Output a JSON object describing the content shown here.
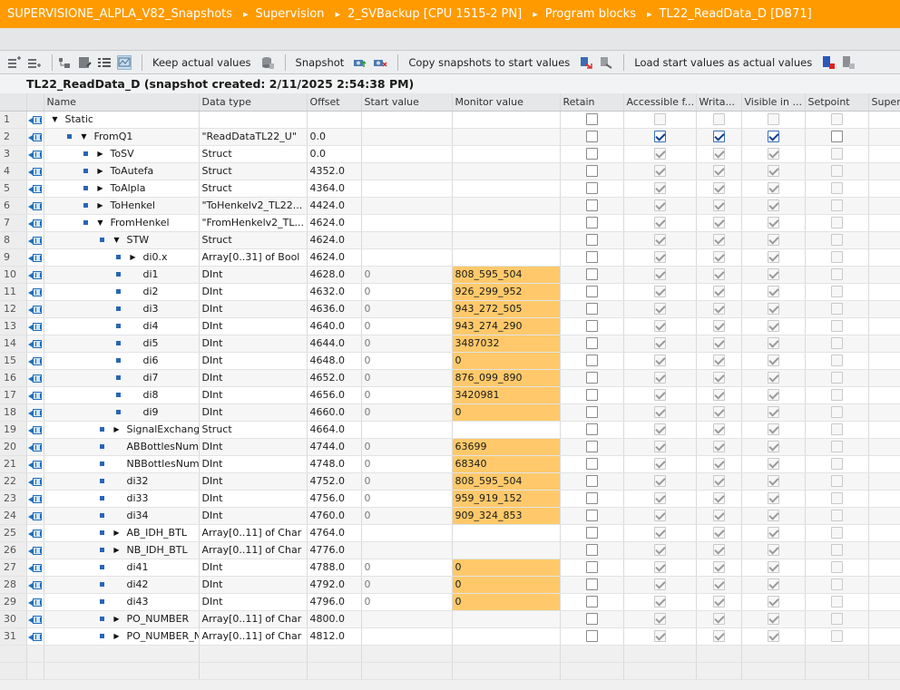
{
  "breadcrumb": [
    "SUPERVISIONE_ALPLA_V82_Snapshots",
    "Supervision",
    "2_SVBackup [CPU 1515-2 PN]",
    "Program blocks",
    "TL22_ReadData_D [DB71]"
  ],
  "toolbar": {
    "keep_actual_values": "Keep actual values",
    "snapshot": "Snapshot",
    "copy_snapshots": "Copy snapshots to start values",
    "load_start_values": "Load start values as actual values"
  },
  "block_title": "TL22_ReadData_D (snapshot created: 2/11/2025 2:54:38 PM)",
  "columns": {
    "name": "Name",
    "data_type": "Data type",
    "offset": "Offset",
    "start_value": "Start value",
    "monitor_value": "Monitor value",
    "retain": "Retain",
    "accessible": "Accessible f...",
    "writable": "Writa...",
    "visible": "Visible in ...",
    "setpoint": "Setpoint",
    "supervision": "Super"
  },
  "rows": [
    {
      "n": "1",
      "name": "Static",
      "type": "",
      "offset": "",
      "start": "",
      "monitor": "",
      "level": 0,
      "tri": "down",
      "bullet": false,
      "hl": false,
      "acc": false,
      "wr": false,
      "vis": false,
      "dim": true
    },
    {
      "n": "2",
      "name": "FromQ1",
      "type": "\"ReadDataTL22_U\"",
      "offset": "0.0",
      "start": "",
      "monitor": "",
      "level": 1,
      "tri": "down",
      "bullet": true,
      "hl": false,
      "acc": true,
      "wr": true,
      "vis": true,
      "dim": false,
      "blue": true
    },
    {
      "n": "3",
      "name": "ToSV",
      "type": "Struct",
      "offset": "0.0",
      "start": "",
      "monitor": "",
      "level": 2,
      "tri": "right",
      "bullet": true,
      "hl": false,
      "acc": true,
      "wr": true,
      "vis": true,
      "dim": true
    },
    {
      "n": "4",
      "name": "ToAutefa",
      "type": "Struct",
      "offset": "4352.0",
      "start": "",
      "monitor": "",
      "level": 2,
      "tri": "right",
      "bullet": true,
      "hl": false,
      "acc": true,
      "wr": true,
      "vis": true,
      "dim": true
    },
    {
      "n": "5",
      "name": "ToAlpla",
      "type": "Struct",
      "offset": "4364.0",
      "start": "",
      "monitor": "",
      "level": 2,
      "tri": "right",
      "bullet": true,
      "hl": false,
      "acc": true,
      "wr": true,
      "vis": true,
      "dim": true
    },
    {
      "n": "6",
      "name": "ToHenkel",
      "type": "\"ToHenkelv2_TL22...",
      "offset": "4424.0",
      "start": "",
      "monitor": "",
      "level": 2,
      "tri": "right",
      "bullet": true,
      "hl": false,
      "acc": true,
      "wr": true,
      "vis": true,
      "dim": true
    },
    {
      "n": "7",
      "name": "FromHenkel",
      "type": "\"FromHenkelv2_TL...",
      "offset": "4624.0",
      "start": "",
      "monitor": "",
      "level": 2,
      "tri": "down",
      "bullet": true,
      "hl": false,
      "acc": true,
      "wr": true,
      "vis": true,
      "dim": true
    },
    {
      "n": "8",
      "name": "STW",
      "type": "Struct",
      "offset": "4624.0",
      "start": "",
      "monitor": "",
      "level": 3,
      "tri": "down",
      "bullet": true,
      "hl": false,
      "acc": true,
      "wr": true,
      "vis": true,
      "dim": true
    },
    {
      "n": "9",
      "name": "di0.x",
      "type": "Array[0..31] of Bool",
      "offset": "4624.0",
      "start": "",
      "monitor": "",
      "level": 4,
      "tri": "right",
      "bullet": true,
      "hl": false,
      "acc": true,
      "wr": true,
      "vis": true,
      "dim": true
    },
    {
      "n": "10",
      "name": "di1",
      "type": "DInt",
      "offset": "4628.0",
      "start": "0",
      "monitor": "808_595_504",
      "level": 4,
      "tri": "",
      "bullet": true,
      "hl": true,
      "acc": true,
      "wr": true,
      "vis": true,
      "dim": true
    },
    {
      "n": "11",
      "name": "di2",
      "type": "DInt",
      "offset": "4632.0",
      "start": "0",
      "monitor": "926_299_952",
      "level": 4,
      "tri": "",
      "bullet": true,
      "hl": true,
      "acc": true,
      "wr": true,
      "vis": true,
      "dim": true
    },
    {
      "n": "12",
      "name": "di3",
      "type": "DInt",
      "offset": "4636.0",
      "start": "0",
      "monitor": "943_272_505",
      "level": 4,
      "tri": "",
      "bullet": true,
      "hl": true,
      "acc": true,
      "wr": true,
      "vis": true,
      "dim": true
    },
    {
      "n": "13",
      "name": "di4",
      "type": "DInt",
      "offset": "4640.0",
      "start": "0",
      "monitor": "943_274_290",
      "level": 4,
      "tri": "",
      "bullet": true,
      "hl": true,
      "acc": true,
      "wr": true,
      "vis": true,
      "dim": true
    },
    {
      "n": "14",
      "name": "di5",
      "type": "DInt",
      "offset": "4644.0",
      "start": "0",
      "monitor": "3487032",
      "level": 4,
      "tri": "",
      "bullet": true,
      "hl": true,
      "acc": true,
      "wr": true,
      "vis": true,
      "dim": true
    },
    {
      "n": "15",
      "name": "di6",
      "type": "DInt",
      "offset": "4648.0",
      "start": "0",
      "monitor": "0",
      "level": 4,
      "tri": "",
      "bullet": true,
      "hl": true,
      "acc": true,
      "wr": true,
      "vis": true,
      "dim": true
    },
    {
      "n": "16",
      "name": "di7",
      "type": "DInt",
      "offset": "4652.0",
      "start": "0",
      "monitor": "876_099_890",
      "level": 4,
      "tri": "",
      "bullet": true,
      "hl": true,
      "acc": true,
      "wr": true,
      "vis": true,
      "dim": true
    },
    {
      "n": "17",
      "name": "di8",
      "type": "DInt",
      "offset": "4656.0",
      "start": "0",
      "monitor": "3420981",
      "level": 4,
      "tri": "",
      "bullet": true,
      "hl": true,
      "acc": true,
      "wr": true,
      "vis": true,
      "dim": true
    },
    {
      "n": "18",
      "name": "di9",
      "type": "DInt",
      "offset": "4660.0",
      "start": "0",
      "monitor": "0",
      "level": 4,
      "tri": "",
      "bullet": true,
      "hl": true,
      "acc": true,
      "wr": true,
      "vis": true,
      "dim": true
    },
    {
      "n": "19",
      "name": "SignalExchange",
      "type": "Struct",
      "offset": "4664.0",
      "start": "",
      "monitor": "",
      "level": 3,
      "tri": "right",
      "bullet": true,
      "hl": false,
      "acc": true,
      "wr": true,
      "vis": true,
      "dim": true
    },
    {
      "n": "20",
      "name": "ABBottlesNum...",
      "type": "DInt",
      "offset": "4744.0",
      "start": "0",
      "monitor": "63699",
      "level": 3,
      "tri": "",
      "bullet": true,
      "hl": true,
      "acc": true,
      "wr": true,
      "vis": true,
      "dim": true
    },
    {
      "n": "21",
      "name": "NBBottlesNum...",
      "type": "DInt",
      "offset": "4748.0",
      "start": "0",
      "monitor": "68340",
      "level": 3,
      "tri": "",
      "bullet": true,
      "hl": true,
      "acc": true,
      "wr": true,
      "vis": true,
      "dim": true
    },
    {
      "n": "22",
      "name": "di32",
      "type": "DInt",
      "offset": "4752.0",
      "start": "0",
      "monitor": "808_595_504",
      "level": 3,
      "tri": "",
      "bullet": true,
      "hl": true,
      "acc": true,
      "wr": true,
      "vis": true,
      "dim": true
    },
    {
      "n": "23",
      "name": "di33",
      "type": "DInt",
      "offset": "4756.0",
      "start": "0",
      "monitor": "959_919_152",
      "level": 3,
      "tri": "",
      "bullet": true,
      "hl": true,
      "acc": true,
      "wr": true,
      "vis": true,
      "dim": true
    },
    {
      "n": "24",
      "name": "di34",
      "type": "DInt",
      "offset": "4760.0",
      "start": "0",
      "monitor": "909_324_853",
      "level": 3,
      "tri": "",
      "bullet": true,
      "hl": true,
      "acc": true,
      "wr": true,
      "vis": true,
      "dim": true
    },
    {
      "n": "25",
      "name": "AB_IDH_BTL",
      "type": "Array[0..11] of Char",
      "offset": "4764.0",
      "start": "",
      "monitor": "",
      "level": 3,
      "tri": "right",
      "bullet": true,
      "hl": false,
      "acc": true,
      "wr": true,
      "vis": true,
      "dim": true
    },
    {
      "n": "26",
      "name": "NB_IDH_BTL",
      "type": "Array[0..11] of Char",
      "offset": "4776.0",
      "start": "",
      "monitor": "",
      "level": 3,
      "tri": "right",
      "bullet": true,
      "hl": false,
      "acc": true,
      "wr": true,
      "vis": true,
      "dim": true
    },
    {
      "n": "27",
      "name": "di41",
      "type": "DInt",
      "offset": "4788.0",
      "start": "0",
      "monitor": "0",
      "level": 3,
      "tri": "",
      "bullet": true,
      "hl": true,
      "acc": true,
      "wr": true,
      "vis": true,
      "dim": true
    },
    {
      "n": "28",
      "name": "di42",
      "type": "DInt",
      "offset": "4792.0",
      "start": "0",
      "monitor": "0",
      "level": 3,
      "tri": "",
      "bullet": true,
      "hl": true,
      "acc": true,
      "wr": true,
      "vis": true,
      "dim": true
    },
    {
      "n": "29",
      "name": "di43",
      "type": "DInt",
      "offset": "4796.0",
      "start": "0",
      "monitor": "0",
      "level": 3,
      "tri": "",
      "bullet": true,
      "hl": true,
      "acc": true,
      "wr": true,
      "vis": true,
      "dim": true
    },
    {
      "n": "30",
      "name": "PO_NUMBER",
      "type": "Array[0..11] of Char",
      "offset": "4800.0",
      "start": "",
      "monitor": "",
      "level": 3,
      "tri": "right",
      "bullet": true,
      "hl": false,
      "acc": true,
      "wr": true,
      "vis": true,
      "dim": true
    },
    {
      "n": "31",
      "name": "PO_NUMBER_N...",
      "type": "Array[0..11] of Char",
      "offset": "4812.0",
      "start": "",
      "monitor": "",
      "level": 3,
      "tri": "right",
      "bullet": true,
      "hl": false,
      "acc": true,
      "wr": true,
      "vis": true,
      "dim": true
    }
  ]
}
